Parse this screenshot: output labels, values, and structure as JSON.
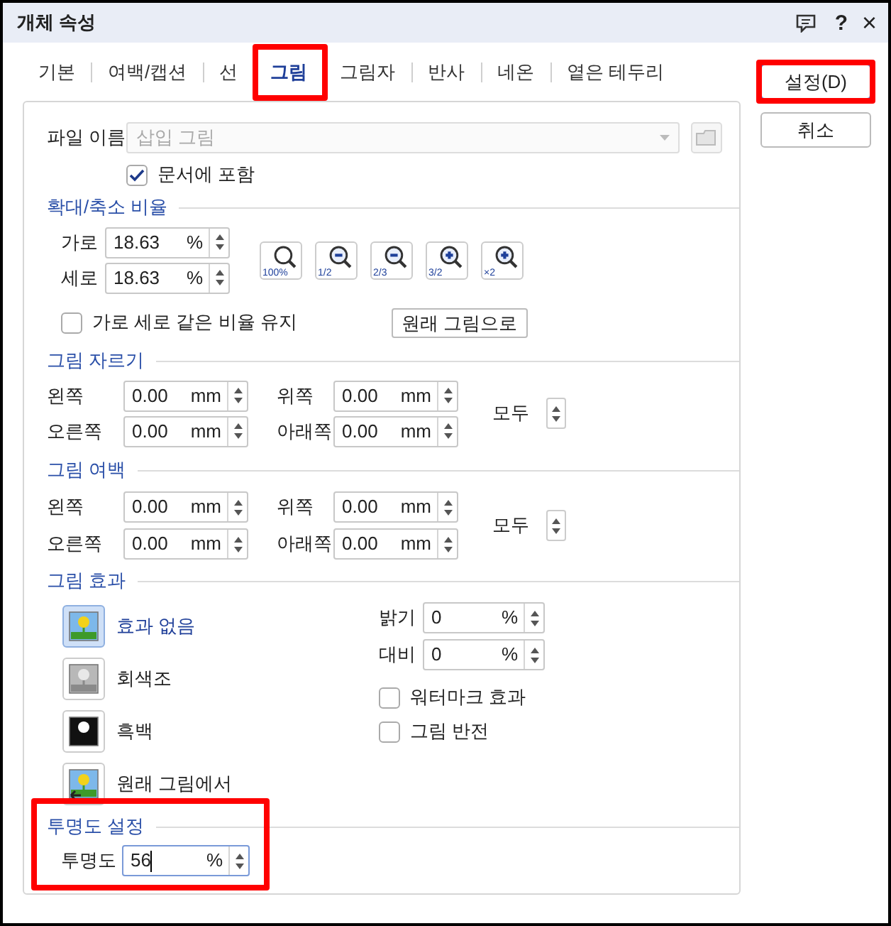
{
  "window": {
    "title": "개체 속성",
    "help": "?",
    "close": "×"
  },
  "tabs": [
    {
      "label": "기본",
      "selected": false,
      "highlighted": false
    },
    {
      "label": "여백/캡션",
      "selected": false,
      "highlighted": false
    },
    {
      "label": "선",
      "selected": false,
      "highlighted": false
    },
    {
      "label": "그림",
      "selected": true,
      "highlighted": true
    },
    {
      "label": "그림자",
      "selected": false,
      "highlighted": false
    },
    {
      "label": "반사",
      "selected": false,
      "highlighted": false
    },
    {
      "label": "네온",
      "selected": false,
      "highlighted": false
    },
    {
      "label": "옅은 테두리",
      "selected": false,
      "highlighted": false
    }
  ],
  "buttons": [
    {
      "label": "설정(D)",
      "default": true,
      "highlighted": true
    },
    {
      "label": "취소",
      "default": false,
      "highlighted": false
    }
  ],
  "file_name": {
    "label": "파일 이름",
    "value": "삽입 그림",
    "disabled": true
  },
  "include_in_document": {
    "label": "문서에 포함",
    "checked": true
  },
  "scale": {
    "title": "확대/축소 비율",
    "fields": [
      {
        "label": "가로",
        "value": "18.63",
        "unit": "%"
      },
      {
        "label": "세로",
        "value": "18.63",
        "unit": "%"
      }
    ],
    "zoom_buttons": [
      {
        "kind": "actual",
        "label": "100%"
      },
      {
        "kind": "out",
        "label": "1/2"
      },
      {
        "kind": "out",
        "label": "2/3"
      },
      {
        "kind": "in",
        "label": "3/2"
      },
      {
        "kind": "in",
        "label": "×2"
      }
    ],
    "keep_ratio": {
      "label": "가로 세로 같은 비율 유지",
      "checked": false
    },
    "original_button": "원래 그림으로"
  },
  "crop": {
    "title": "그림 자르기",
    "fields": [
      {
        "label": "왼쪽",
        "value": "0.00",
        "unit": "mm"
      },
      {
        "label": "위쪽",
        "value": "0.00",
        "unit": "mm"
      },
      {
        "label": "오른쪽",
        "value": "0.00",
        "unit": "mm"
      },
      {
        "label": "아래쪽",
        "value": "0.00",
        "unit": "mm"
      }
    ],
    "all_label": "모두"
  },
  "margin": {
    "title": "그림 여백",
    "fields": [
      {
        "label": "왼쪽",
        "value": "0.00",
        "unit": "mm"
      },
      {
        "label": "위쪽",
        "value": "0.00",
        "unit": "mm"
      },
      {
        "label": "오른쪽",
        "value": "0.00",
        "unit": "mm"
      },
      {
        "label": "아래쪽",
        "value": "0.00",
        "unit": "mm"
      }
    ],
    "all_label": "모두"
  },
  "effects": {
    "title": "그림 효과",
    "options": [
      {
        "kind": "color",
        "label": "효과 없음",
        "selected": true
      },
      {
        "kind": "gray",
        "label": "회색조",
        "selected": false
      },
      {
        "kind": "mono",
        "label": "흑백",
        "selected": false
      },
      {
        "kind": "original",
        "label": "원래 그림에서",
        "selected": false
      }
    ],
    "fields": [
      {
        "label": "밝기",
        "value": "0",
        "unit": "%"
      },
      {
        "label": "대비",
        "value": "0",
        "unit": "%"
      }
    ],
    "checkboxes": [
      {
        "label": "워터마크 효과",
        "checked": false
      },
      {
        "label": "그림 반전",
        "checked": false
      }
    ]
  },
  "transparency": {
    "title": "투명도 설정",
    "highlighted": true,
    "field": {
      "label": "투명도",
      "value": "56",
      "unit": "%",
      "focused": true
    }
  }
}
